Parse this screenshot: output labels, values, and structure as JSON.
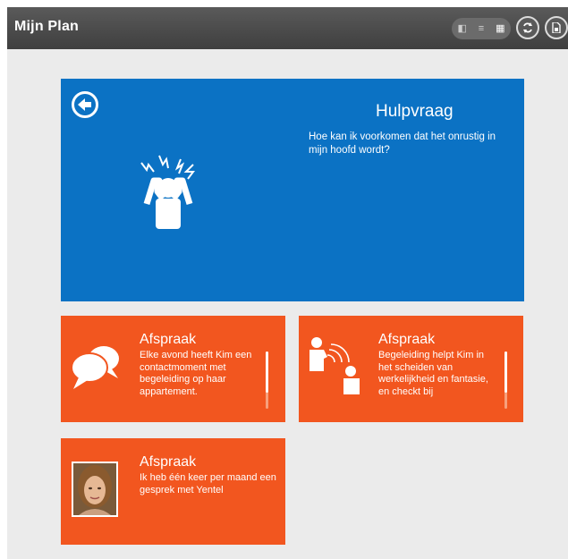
{
  "app": {
    "title": "Mijn Plan"
  },
  "header": {
    "view_icons": [
      "card-view-icon",
      "list-view-icon",
      "grid-view-icon"
    ],
    "buttons": [
      "sync-icon",
      "document-icon"
    ]
  },
  "help_card": {
    "title": "Hulpvraag",
    "text": "Hoe kan ik voorkomen dat het onrustig in mijn hoofd wordt?",
    "illustration": "stressed-person-icon"
  },
  "cards": [
    {
      "title": "Afspraak",
      "text": "Elke avond heeft Kim een contactmoment met begeleiding op haar appartement.",
      "icon": "speech-bubbles-icon"
    },
    {
      "title": "Afspraak",
      "text": "Begeleiding helpt Kim in het scheiden van werkelijkheid en fantasie, en checkt bij",
      "icon": "people-talking-icon"
    },
    {
      "title": "Afspraak",
      "text": "Ik heb één keer per maand een gesprek met Yentel",
      "icon": "avatar-photo"
    }
  ],
  "colors": {
    "header": "#4b4b4b",
    "background": "#ebebeb",
    "help": "#0b72c4",
    "afspraak": "#f2561f"
  }
}
